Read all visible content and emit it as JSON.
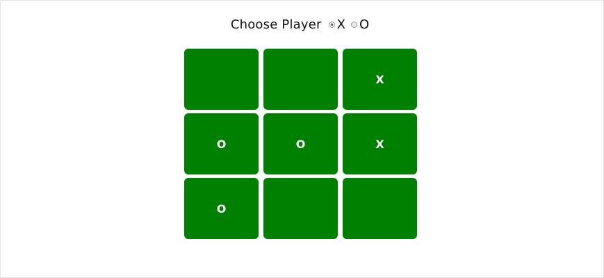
{
  "chooser": {
    "label": "Choose Player",
    "options": [
      {
        "label": "X",
        "selected": true
      },
      {
        "label": "O",
        "selected": false
      }
    ]
  },
  "board": {
    "cell_color": "#008000",
    "mark_color": "#ffffff",
    "cells": [
      "",
      "",
      "X",
      "O",
      "O",
      "X",
      "O",
      "",
      ""
    ]
  }
}
